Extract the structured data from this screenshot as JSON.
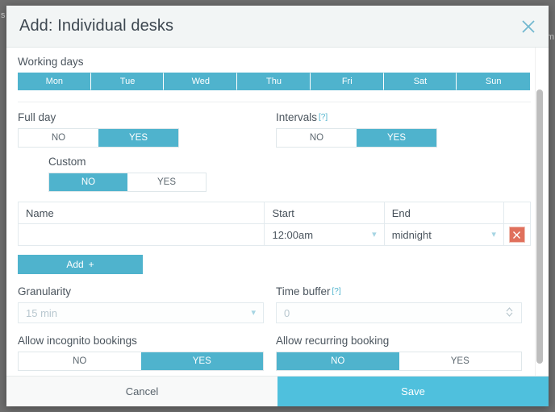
{
  "background": {
    "edge_left_text": "s",
    "edge_right_text": "m"
  },
  "colors": {
    "accent": "#4fb3cd",
    "save": "#4fc0dd",
    "danger": "#e0705c",
    "backdrop": "#6e6e6e",
    "header_bg": "#f2f5f5"
  },
  "header": {
    "title": "Add: Individual desks",
    "close_icon": "close-icon"
  },
  "working_days": {
    "label": "Working days",
    "days": [
      {
        "label": "Mon",
        "selected": true
      },
      {
        "label": "Tue",
        "selected": true
      },
      {
        "label": "Wed",
        "selected": true
      },
      {
        "label": "Thu",
        "selected": true
      },
      {
        "label": "Fri",
        "selected": true
      },
      {
        "label": "Sat",
        "selected": true
      },
      {
        "label": "Sun",
        "selected": true
      }
    ]
  },
  "full_day": {
    "label": "Full day",
    "no_label": "NO",
    "yes_label": "YES",
    "value": "YES"
  },
  "intervals": {
    "label": "Intervals",
    "help": "[?]",
    "no_label": "NO",
    "yes_label": "YES",
    "value": "YES"
  },
  "custom": {
    "label": "Custom",
    "no_label": "NO",
    "yes_label": "YES",
    "value": "NO"
  },
  "table": {
    "columns": [
      "Name",
      "Start",
      "End",
      ""
    ],
    "rows": [
      {
        "name": "",
        "start": "12:00am",
        "end": "midnight",
        "delete_icon": "close-icon"
      }
    ],
    "add_label": "Add",
    "add_icon": "plus-icon"
  },
  "granularity": {
    "label": "Granularity",
    "value": "15 min",
    "chevron_icon": "chevron-down-icon"
  },
  "time_buffer": {
    "label": "Time buffer",
    "help": "[?]",
    "value": "0",
    "stepper_icon": "stepper-icon"
  },
  "incognito": {
    "label": "Allow incognito bookings",
    "no_label": "NO",
    "yes_label": "YES",
    "value": "YES"
  },
  "recurring": {
    "label": "Allow recurring booking",
    "no_label": "NO",
    "yes_label": "YES",
    "value": "NO"
  },
  "footer": {
    "cancel_label": "Cancel",
    "save_label": "Save"
  }
}
